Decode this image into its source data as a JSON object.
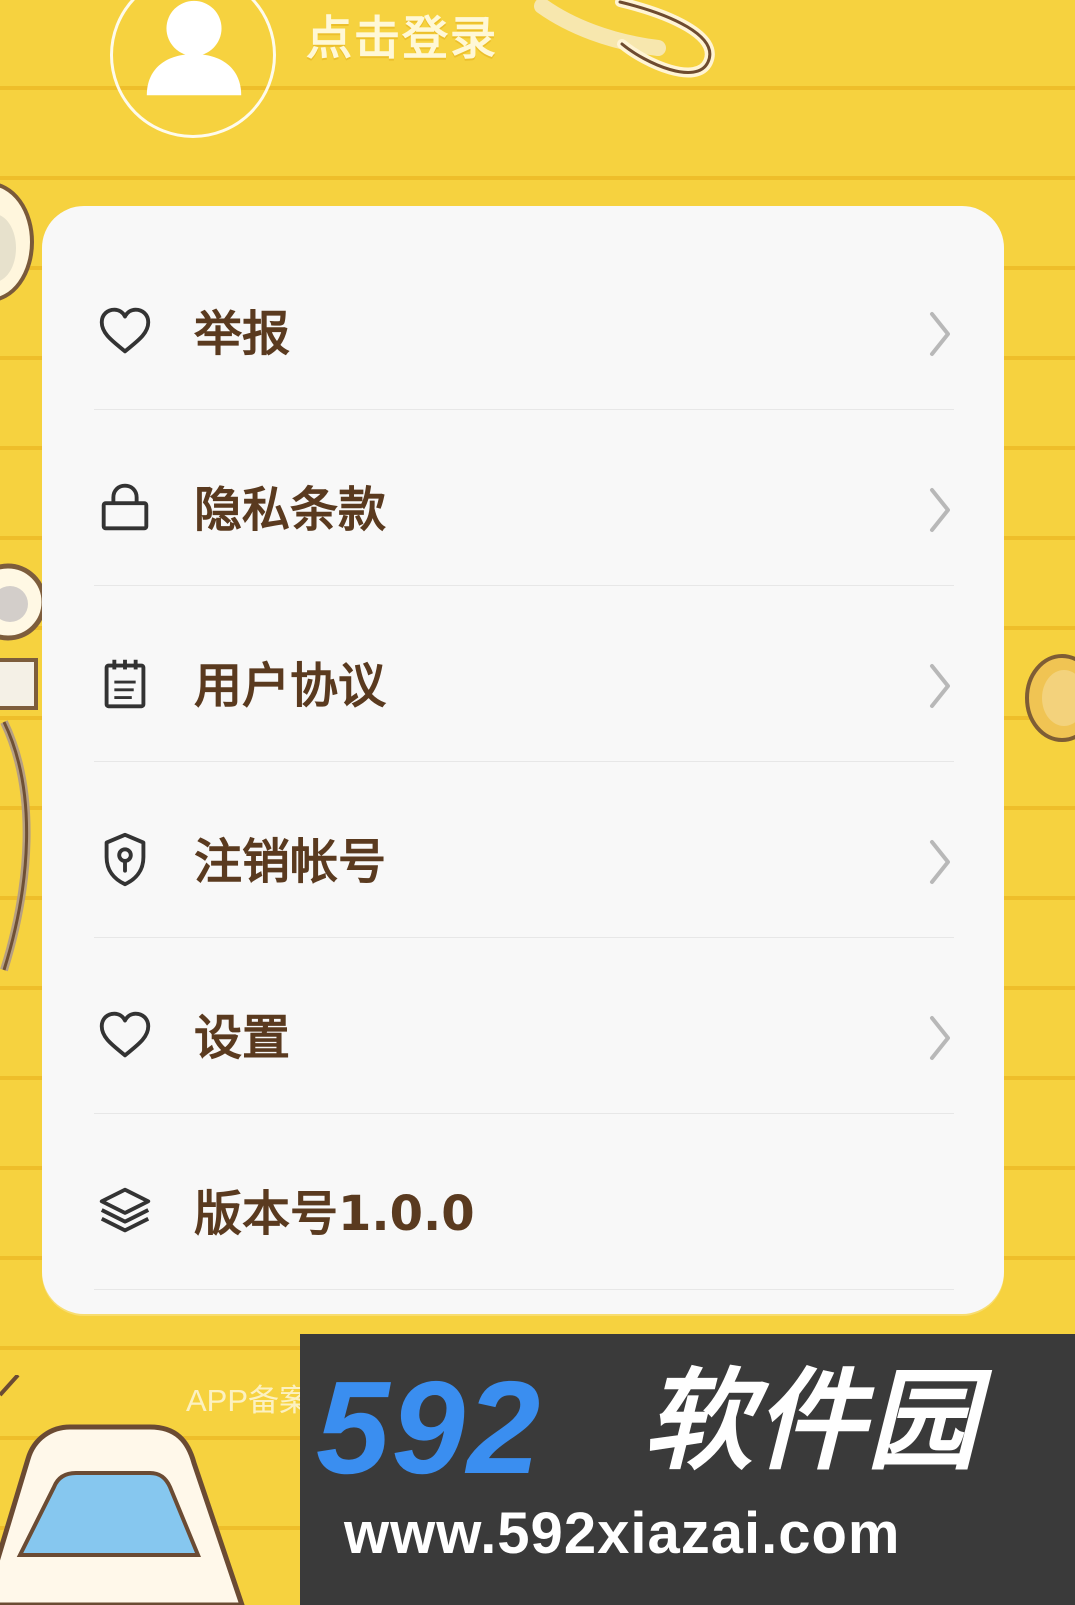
{
  "header": {
    "login_text": "点击登录"
  },
  "menu": [
    {
      "label": "举报",
      "icon": "heart-icon"
    },
    {
      "label": "隐私条款",
      "icon": "lock-icon"
    },
    {
      "label": "用户协议",
      "icon": "notepad-icon"
    },
    {
      "label": "注销帐号",
      "icon": "shield-keyhole-icon"
    },
    {
      "label": "设置",
      "icon": "heart-icon"
    },
    {
      "label": "版本号1.0.0",
      "icon": "layers-icon"
    }
  ],
  "footer": {
    "beian_text": "APP备案"
  },
  "watermark": {
    "brand_number": "592",
    "brand_name": "软件园",
    "url": "www.592xiazai.com"
  },
  "colors": {
    "background": "#f6d23f",
    "card": "#f8f8f8",
    "label": "#5a3a1f",
    "watermark_bg": "#3a3a3a",
    "watermark_blue": "#3a8ef0"
  }
}
